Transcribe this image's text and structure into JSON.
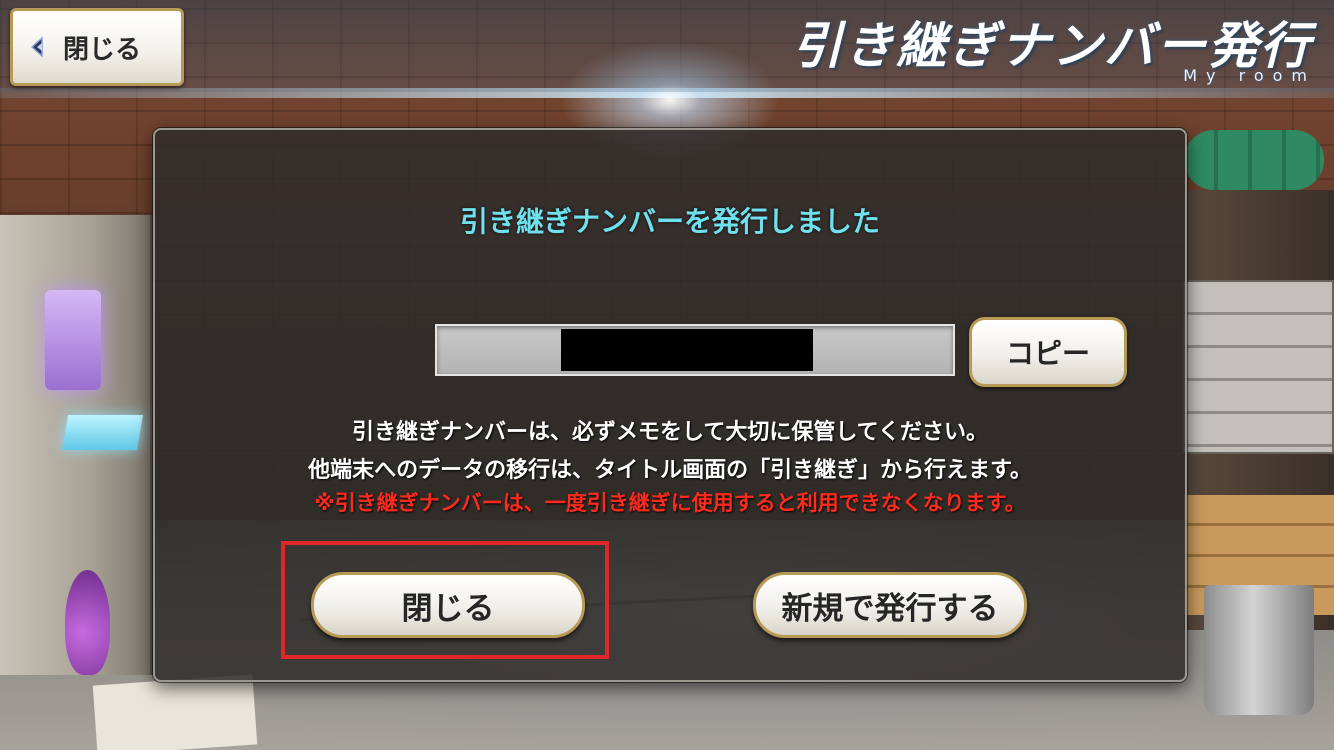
{
  "header": {
    "back_label": "閉じる",
    "title": "引き継ぎナンバー発行",
    "subtitle": "My room"
  },
  "dialog": {
    "title": "引き継ぎナンバーを発行しました",
    "code_value": "",
    "copy_label": "コピー",
    "notice_line1": "引き継ぎナンバーは、必ずメモをして大切に保管してください。",
    "notice_line2": "他端末へのデータの移行は、タイトル画面の「引き継ぎ」から行えます。",
    "warning_line": "※引き継ぎナンバーは、一度引き継ぎに使用すると利用できなくなります。",
    "close_label": "閉じる",
    "new_issue_label": "新規で発行する"
  },
  "colors": {
    "title_cyan": "#6fe0ee",
    "warning_red": "#ff2a1e",
    "highlight_red": "#e0262b",
    "button_border_gold": "#b79a55"
  },
  "icons": {
    "back": "back-arrow-icon"
  }
}
